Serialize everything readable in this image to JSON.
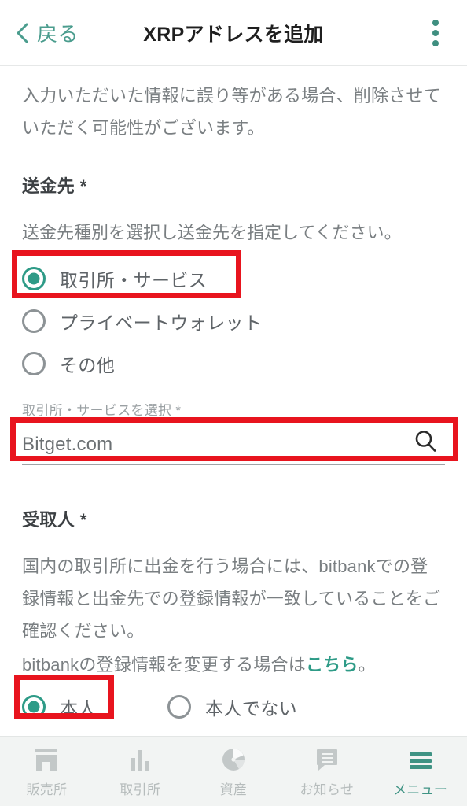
{
  "header": {
    "back_label": "戻る",
    "title": "XRPアドレスを追加",
    "menu_icon": "kebab-menu-icon",
    "back_icon": "chevron-left-icon"
  },
  "content": {
    "intro_text": "入力いただいた情報に誤り等がある場合、削除させていただく可能性がございます。",
    "destination": {
      "title": "送金先 *",
      "subtitle": "送金先種別を選択し送金先を指定してください。",
      "options": [
        {
          "label": "取引所・サービス",
          "checked": true
        },
        {
          "label": "プライベートウォレット",
          "checked": false
        },
        {
          "label": "その他",
          "checked": false
        }
      ]
    },
    "service_select": {
      "label": "取引所・サービスを選択 *",
      "value": "Bitget.com",
      "placeholder": "取引所・サービスを選択",
      "icon": "search-icon"
    },
    "recipient": {
      "title": "受取人 *",
      "description": "国内の取引所に出金を行う場合には、bitbankでの登録情報と出金先での登録情報が一致していることをご確認ください。",
      "link_line_prefix": "bitbankの登録情報を変更する場合は",
      "link_text": "こちら",
      "link_line_suffix": "。",
      "options": [
        {
          "label": "本人",
          "checked": true
        },
        {
          "label": "本人でない",
          "checked": false
        }
      ]
    }
  },
  "tabbar": {
    "items": [
      {
        "label": "販売所",
        "icon": "store-icon",
        "active": false
      },
      {
        "label": "取引所",
        "icon": "bar-chart-icon",
        "active": false
      },
      {
        "label": "資産",
        "icon": "pie-chart-icon",
        "active": false
      },
      {
        "label": "お知らせ",
        "icon": "chat-bubble-icon",
        "active": false
      },
      {
        "label": "メニュー",
        "icon": "hamburger-icon",
        "active": true
      }
    ]
  },
  "annotations": {
    "boxes": [
      {
        "name": "highlight-exchange-service-option",
        "color": "#e8141e"
      },
      {
        "name": "highlight-service-search-field",
        "color": "#e8141e"
      },
      {
        "name": "highlight-self-recipient-option",
        "color": "#e8141e"
      }
    ]
  },
  "colors": {
    "accent_teal": "#2e9b87",
    "link_teal": "#3f9384",
    "annotation_red": "#e8141e",
    "body_gray": "#7a7f82",
    "tab_inactive": "#b6bcbc"
  }
}
